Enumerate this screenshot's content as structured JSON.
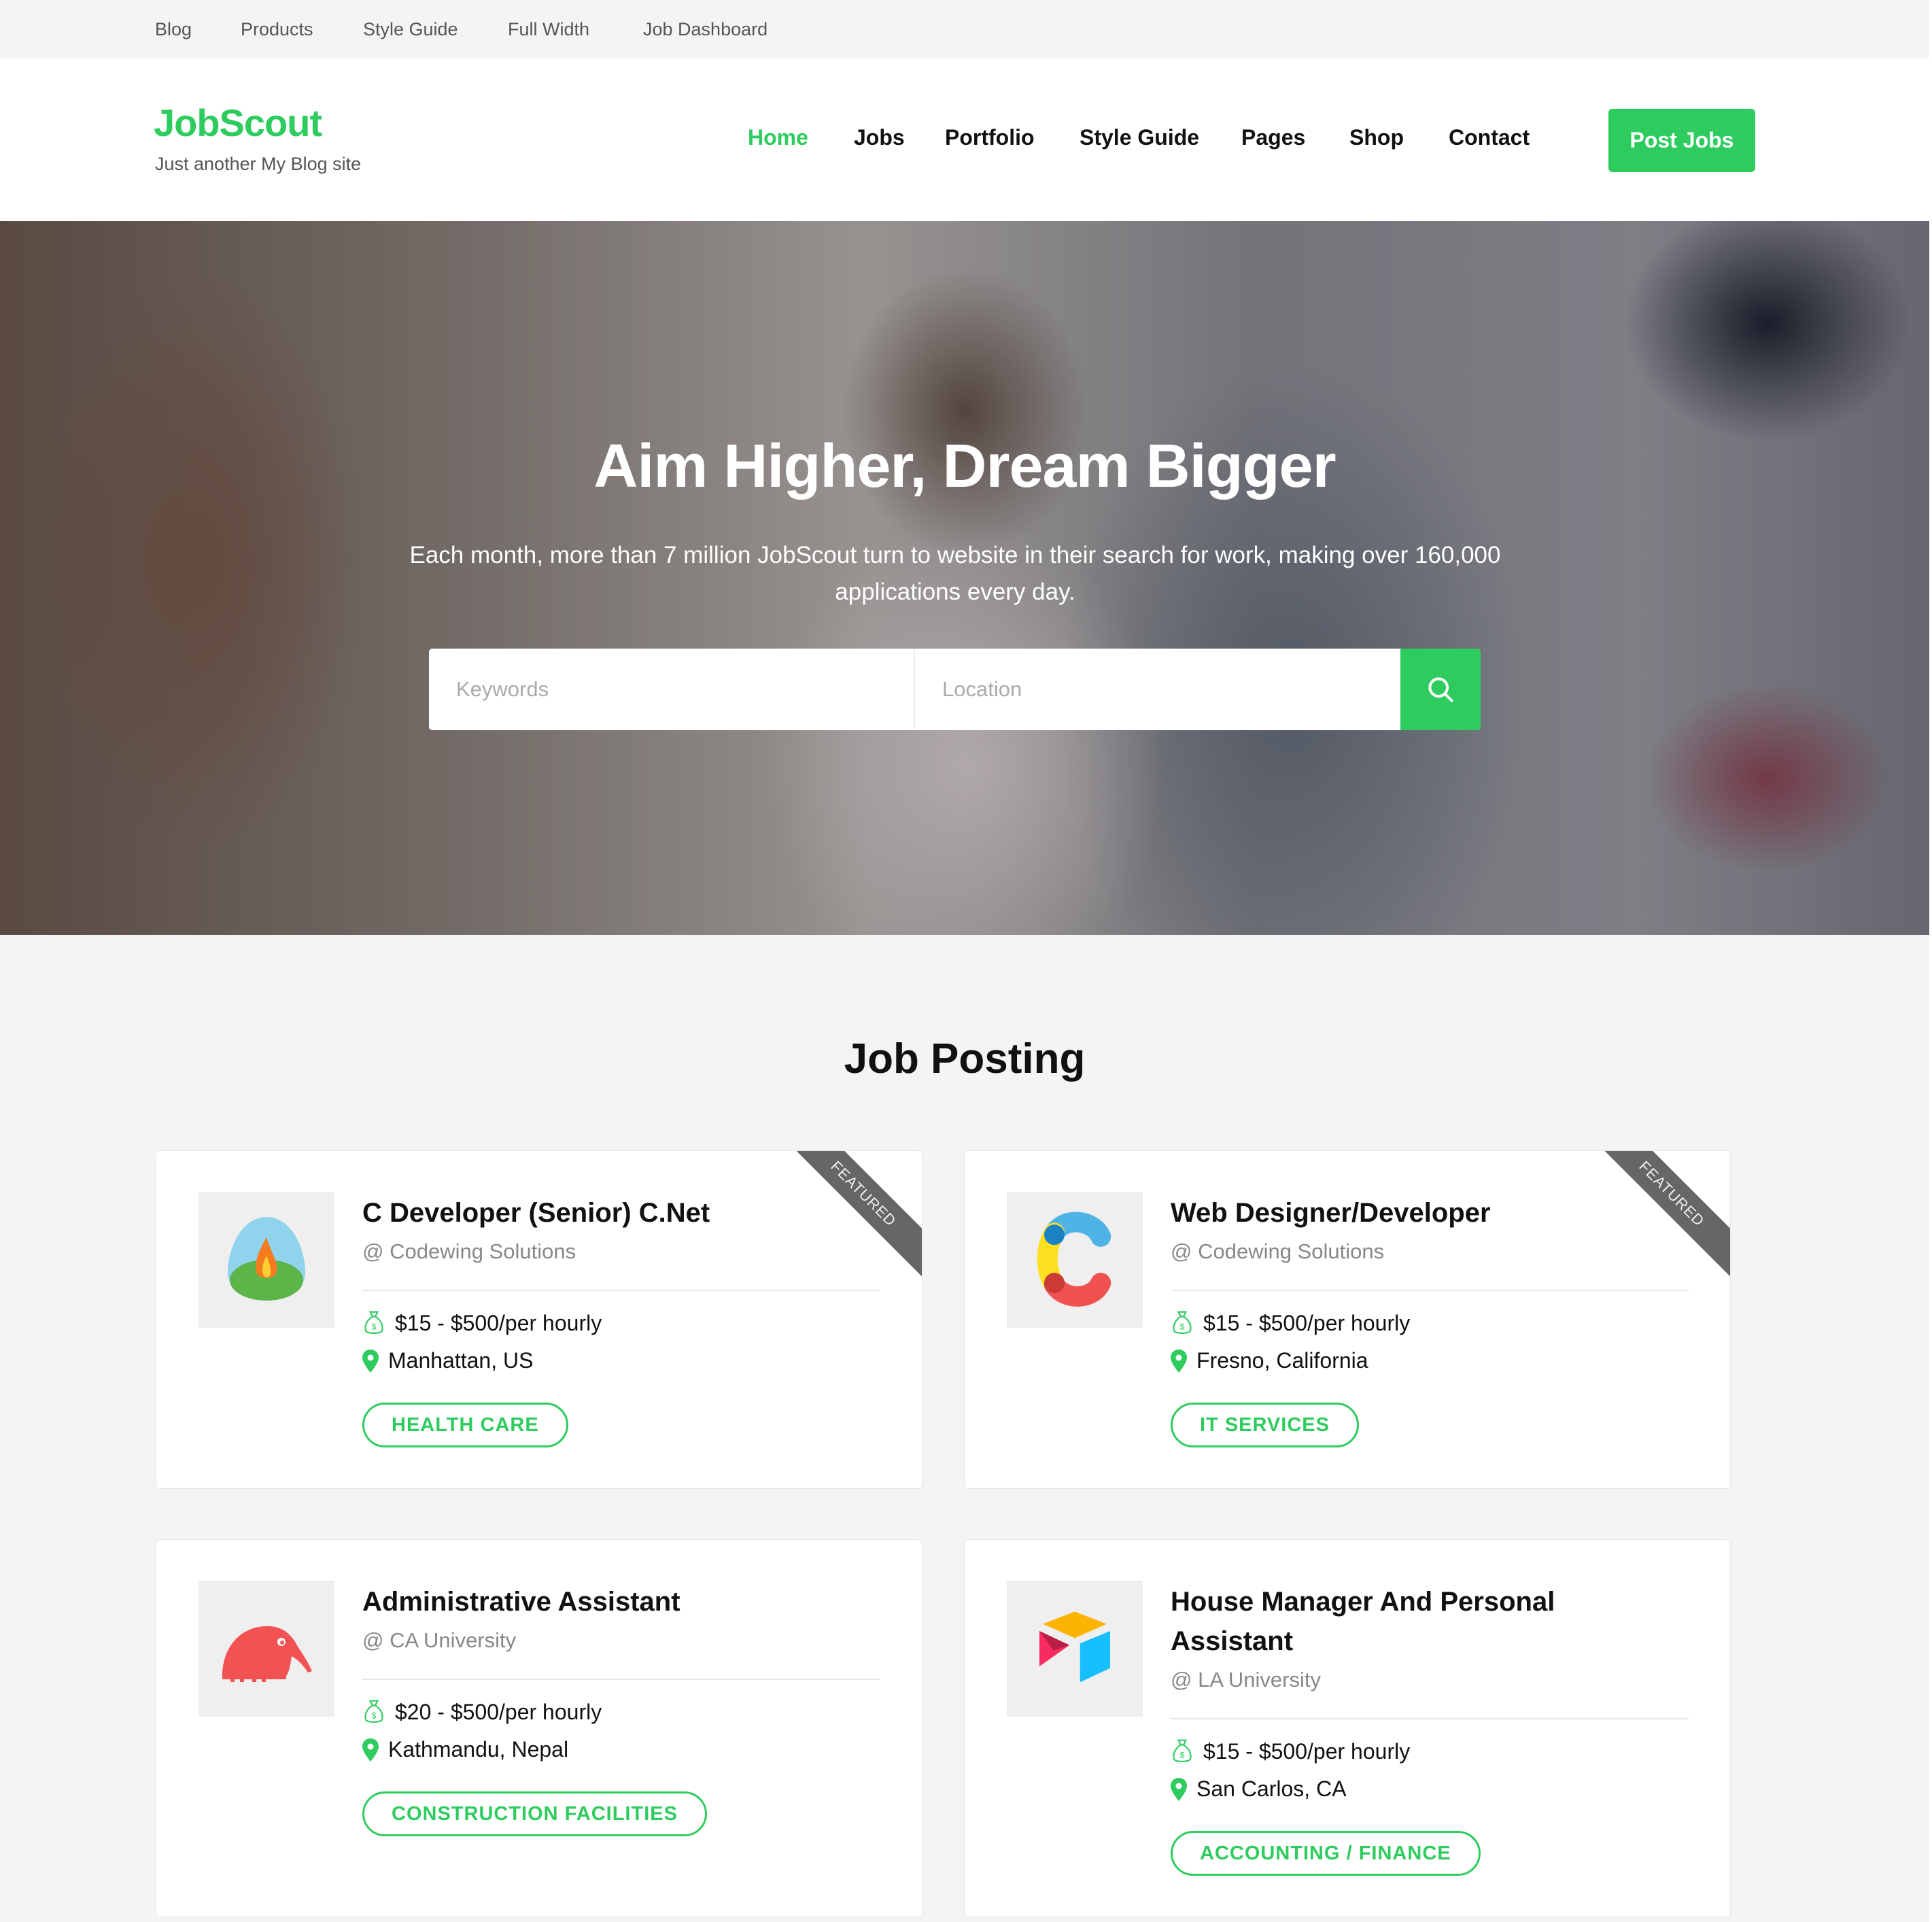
{
  "topbar": {
    "links": [
      {
        "label": "Blog"
      },
      {
        "label": "Products"
      },
      {
        "label": "Style Guide"
      },
      {
        "label": "Full Width"
      },
      {
        "label": "Job Dashboard"
      }
    ]
  },
  "header": {
    "logo": "JobScout",
    "tagline": "Just another My Blog site",
    "nav": [
      {
        "label": "Home",
        "active": true
      },
      {
        "label": "Jobs"
      },
      {
        "label": "Portfolio"
      },
      {
        "label": "Style Guide"
      },
      {
        "label": "Pages"
      },
      {
        "label": "Shop"
      },
      {
        "label": "Contact"
      }
    ],
    "cta_label": "Post Jobs"
  },
  "hero": {
    "title": "Aim Higher, Dream Bigger",
    "subtitle": "Each month, more than 7 million JobScout turn to website in their search for work, making over 160,000 applications every day.",
    "search": {
      "keywords_placeholder": "Keywords",
      "location_placeholder": "Location",
      "button_icon": "search-icon"
    }
  },
  "jobs_section": {
    "title": "Job Posting",
    "jobs": [
      {
        "title": "C Developer (Senior) C.Net",
        "company": "@ Codewing Solutions",
        "salary": "$15 - $500/per hourly",
        "location": "Manhattan, US",
        "category": "HEALTH CARE",
        "featured": "FEATURED",
        "logo_icon": "campfire-logo-icon"
      },
      {
        "title": "Web Designer/Developer",
        "company": "@ Codewing Solutions",
        "salary": "$15 - $500/per hourly",
        "location": "Fresno, California",
        "category": "IT SERVICES",
        "featured": "FEATURED",
        "logo_icon": "c-letter-logo-icon"
      },
      {
        "title": "Administrative Assistant",
        "company": "@ CA University",
        "salary": "$20 - $500/per hourly",
        "location": "Kathmandu, Nepal",
        "category": "CONSTRUCTION FACILITIES",
        "logo_icon": "anteater-logo-icon"
      },
      {
        "title": "House Manager And Personal Assistant",
        "company": "@ LA University",
        "salary": "$15 - $500/per hourly",
        "location": "San Carlos, CA",
        "category": "ACCOUNTING / FINANCE",
        "logo_icon": "cube-logo-icon"
      }
    ]
  },
  "colors": {
    "accent": "#2ecc5e",
    "page_bg": "#f4f4f6",
    "ribbon": "#666666"
  }
}
